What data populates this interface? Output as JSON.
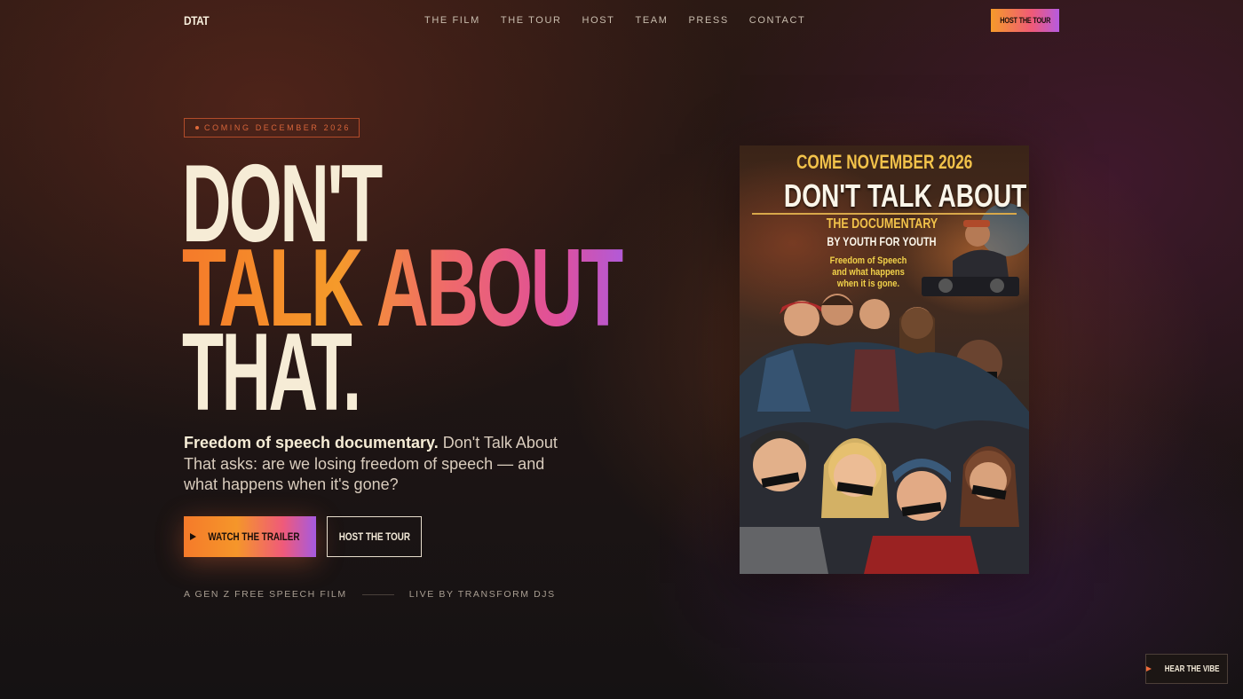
{
  "nav": {
    "logo": "DTAT",
    "links": [
      "THE FILM",
      "THE TOUR",
      "HOST",
      "TEAM",
      "PRESS",
      "CONTACT"
    ],
    "cta": "HOST THE TOUR"
  },
  "hero": {
    "badge": "COMING DECEMBER 2026",
    "headline": [
      "DON'T",
      "TALK ABOUT",
      "THAT."
    ],
    "sub_strong": "Freedom of speech documentary.",
    "sub_rest": " Don't Talk About That asks: are we losing freedom of speech — and what happens when it's gone?",
    "primary_button": "WATCH THE TRAILER",
    "secondary_button": "HOST THE TOUR",
    "tagline_left": "A GEN Z FREE SPEECH FILM",
    "tagline_right": "LIVE BY TRANSFORM DJS"
  },
  "poster": {
    "top_line": "COME NOVEMBER 2026",
    "title": "DON'T TALK ABOUT THAT",
    "sub1": "THE DOCUMENTARY",
    "sub2": "BY YOUTH FOR YOUTH",
    "tag_lines": [
      "Freedom of Speech",
      "and what happens",
      "when it is gone."
    ]
  },
  "floating": {
    "label": "HEAR THE VIBE"
  },
  "colors": {
    "accent_orange": "#f57a2a",
    "accent_pink": "#ef5a7a",
    "accent_purple": "#b25ad8",
    "cream": "#f6ecd6"
  }
}
